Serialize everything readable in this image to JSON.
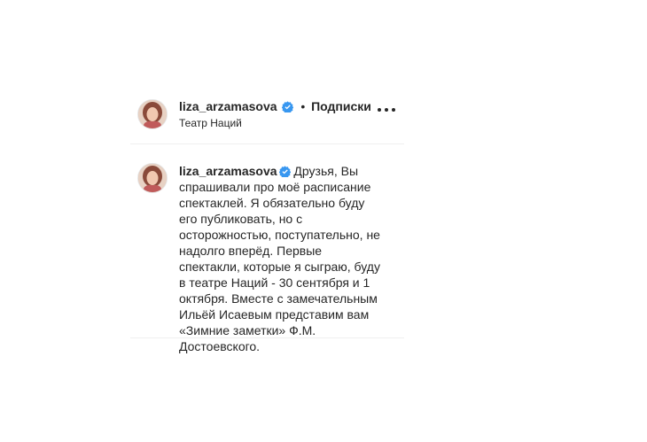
{
  "post_header": {
    "username": "liza_arzamasova",
    "separator": "•",
    "follow_label": "Подписки",
    "location": "Театр Наций"
  },
  "caption": {
    "username": "liza_arzamasova",
    "text": " Друзья, Вы спрашивали про моё расписание спектаклей. Я обязательно буду его публиковать, но с осторожностью, поступательно, не надолго вперёд. Первые спектакли, которые я сыграю, буду в театре Наций - 30 сентября и 1 октября. Вместе с замечательным Ильёй Исаевым представим вам «Зимние заметки» Ф.М. Достоевского."
  },
  "colors": {
    "text": "#262626",
    "verified": "#3897f0",
    "divider": "#efefef"
  },
  "icons": {
    "verified": "verified-badge-icon",
    "more": "more-options-icon"
  }
}
